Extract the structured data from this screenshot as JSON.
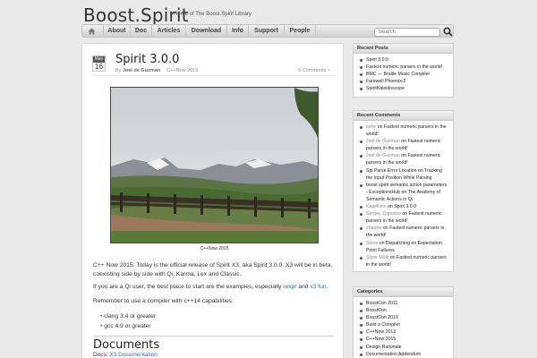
{
  "site": {
    "title": "Boost.Spirit",
    "tagline": "Home of The Boost.Spirit Library"
  },
  "nav": {
    "home_icon": "home-icon",
    "items": [
      "About",
      "Doc",
      "Articles",
      "Download",
      "Info",
      "Support",
      "People"
    ]
  },
  "search": {
    "placeholder": "Search",
    "icon": "magnifier-icon"
  },
  "post": {
    "month": "May",
    "day": "16",
    "title": "Spirit 3.0.0",
    "by": "By",
    "author": "Joel de Guzman",
    "category": "C++Now 2015",
    "comments": "6 Comments »",
    "image_caption": "C++Now 2015",
    "p1": "C++ Now 2015: Today is the official release of Spirit X3, aka Spirit 3.0.0. X3 will be in beta, coexisting side by side with Qi, Karma, Lex and Classic.",
    "p2_pre": "If you are a Qi user, the best place to start are the examples, especially ",
    "p2_link1": "rexpr",
    "p2_mid": " and ",
    "p2_link2": "x3 fun",
    "p2_post": ".",
    "p3": "Remember to use a compiler with c++14 capabilities:",
    "bullets": [
      "clang 3.4 or greater",
      "gcc 4.9 or greater"
    ],
    "section_heading": "Documents",
    "docs_label": "Docs: ",
    "docs_link": "X3 Documentation"
  },
  "sidebar": {
    "recent_posts": {
      "title": "Recent Posts",
      "items": [
        "Spirit 3.0.0",
        "Fastest numeric parsers in the world!",
        "BMC — Braille Music Compiler",
        "Farewell Phoenix-2",
        "SpiritKaleidoscope"
      ]
    },
    "recent_comments": {
      "title": "Recent Comments",
      "items": [
        {
          "who": "sehe",
          "on": " on ",
          "what": "Fastest numeric parsers in the world!"
        },
        {
          "who": "Joel de Guzman",
          "on": " on ",
          "what": "Fastest numeric parsers in the world!"
        },
        {
          "who": "Joel de Guzman",
          "on": " on ",
          "what": "Fastest numeric parsers in the world!"
        },
        {
          "who": "Sql Parse Error Location",
          "on": " on ",
          "what": "Tracking the Input Position While Parsing"
        },
        {
          "who": "boost spirit semantic action parameters - ExceptionsHub",
          "on": " on ",
          "what": "The Anatomy of Semantic Actions in Qi"
        },
        {
          "who": "KageKirin",
          "on": " on ",
          "what": "Spirit 3.0.0"
        },
        {
          "who": "Sergey Zygostev",
          "on": " on ",
          "what": "Fastest numeric parsers in the world!"
        },
        {
          "who": "zhanxw",
          "on": " on ",
          "what": "Fastest numeric parsers in the world!"
        },
        {
          "who": "Steve",
          "on": " on ",
          "what": "Dispatching on Expectation Point Failures"
        },
        {
          "who": "Silver Möls",
          "on": " on ",
          "what": "Fastest numeric parsers in the world!"
        }
      ]
    },
    "categories": {
      "title": "Categories",
      "items": [
        "BoostCon 2011",
        "BoostCon",
        "BoostCon 2010",
        "Build a Compiler",
        "C++Now 2013",
        "C++Now 2015",
        "Design Rationale",
        "Documentation Addendum"
      ]
    }
  }
}
